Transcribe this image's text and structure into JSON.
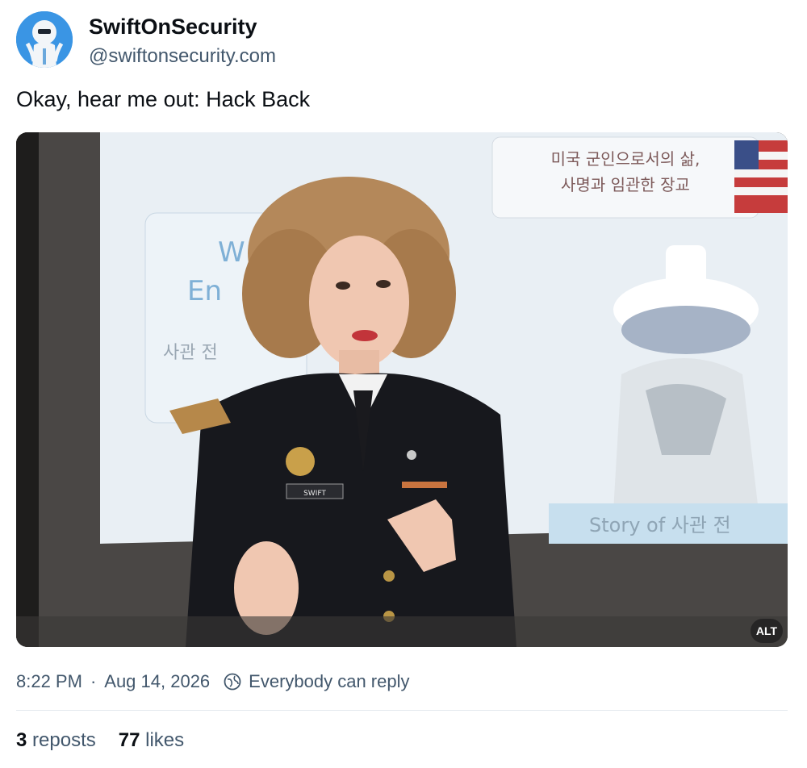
{
  "author": {
    "display_name": "SwiftOnSecurity",
    "handle": "@swiftonsecurity.com",
    "avatar_icon": "mascot-avatar"
  },
  "post": {
    "text": "Okay, hear me out: Hack Back",
    "image_alt_badge": "ALT",
    "image_slide_text": {
      "title_line1": "미국 군인으로서의 삶,",
      "title_line2": "사명과 임관한 장교",
      "caption": "Story of 사관 전",
      "left_word1": "W",
      "left_word2": "En",
      "left_korean": "사관 전",
      "nametag": "SWIFT"
    }
  },
  "meta": {
    "time": "8:22 PM",
    "separator": "·",
    "date": "Aug 14, 2026",
    "reply_setting": "Everybody can reply",
    "reply_icon": "globe-icon"
  },
  "stats": {
    "reposts_count": "3",
    "reposts_label": "reposts",
    "likes_count": "77",
    "likes_label": "likes"
  },
  "colors": {
    "text_primary": "#0b0f14",
    "text_secondary": "#42576c",
    "divider": "#e4e9ee"
  }
}
